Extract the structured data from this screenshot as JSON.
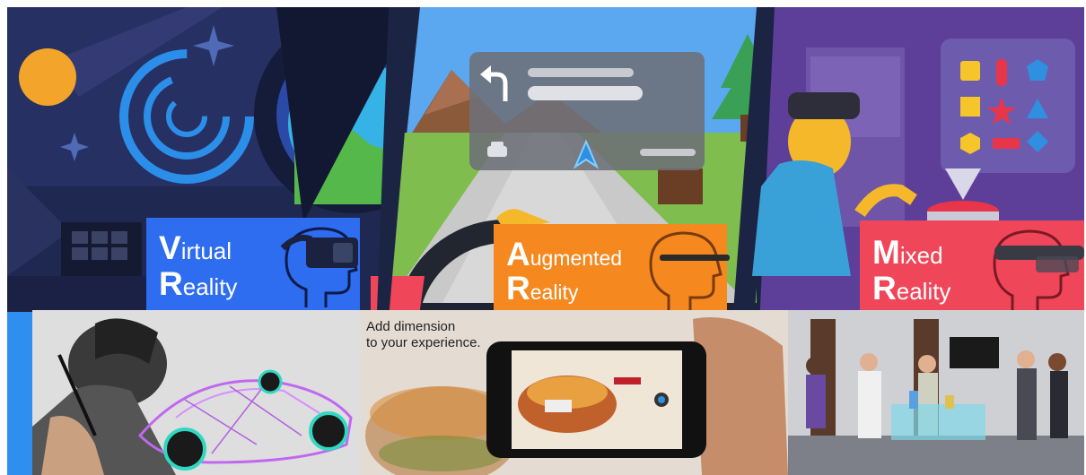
{
  "panels": {
    "vr": {
      "initial_1": "V",
      "rest_1": "irtual",
      "initial_2": "R",
      "rest_2": "eality",
      "color": "#2f6df0"
    },
    "ar": {
      "initial_1": "A",
      "rest_1": "ugmented",
      "initial_2": "R",
      "rest_2": "eality",
      "color": "#f5891f"
    },
    "mr": {
      "initial_1": "M",
      "rest_1": "ixed",
      "initial_2": "R",
      "rest_2": "eality",
      "color": "#f0465a"
    }
  },
  "photos": {
    "ar_caption_1": "Add dimension",
    "ar_caption_2": "to your experience."
  },
  "icons": [
    "vr-headset-icon",
    "ar-glasses-icon",
    "mr-headset-icon",
    "turn-arrow-icon",
    "car-icon",
    "navigation-arrow-icon"
  ]
}
